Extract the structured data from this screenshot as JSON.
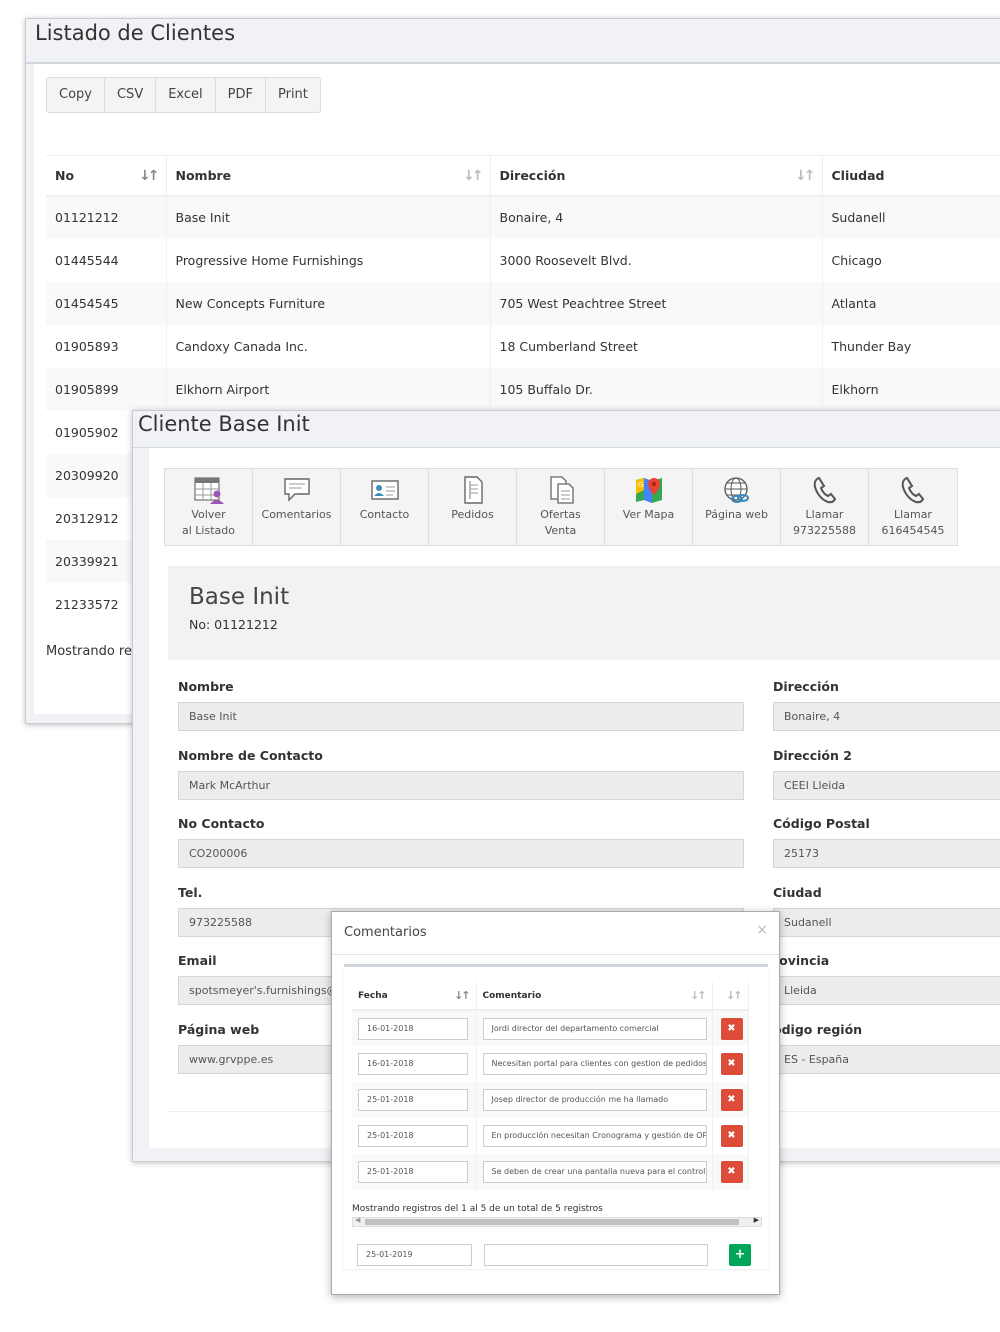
{
  "list_window": {
    "title": "Listado de Clientes",
    "export_buttons": [
      "Copy",
      "CSV",
      "Excel",
      "PDF",
      "Print"
    ],
    "columns": [
      "No",
      "Nombre",
      "Dirección",
      "Cliudad"
    ],
    "rows": [
      [
        "01121212",
        "Base Init",
        "Bonaire, 4",
        "Sudanell"
      ],
      [
        "01445544",
        "Progressive Home Furnishings",
        "3000 Roosevelt Blvd.",
        "Chicago"
      ],
      [
        "01454545",
        "New Concepts Furniture",
        "705 West Peachtree Street",
        "Atlanta"
      ],
      [
        "01905893",
        "Candoxy Canada Inc.",
        "18 Cumberland Street",
        "Thunder Bay"
      ],
      [
        "01905899",
        "Elkhorn Airport",
        "105 Buffalo Dr.",
        "Elkhorn"
      ],
      [
        "01905902",
        "",
        "",
        ""
      ],
      [
        "20309920",
        "",
        "",
        ""
      ],
      [
        "20312912",
        "",
        "",
        ""
      ],
      [
        "20339921",
        "",
        "",
        ""
      ],
      [
        "21233572",
        "",
        "",
        ""
      ]
    ],
    "showing": "Mostrando reg"
  },
  "detail_window": {
    "title": "Cliente Base Init",
    "toolbar": [
      {
        "icon": "list-person-icon",
        "line1": "Volver",
        "line2": "al Listado"
      },
      {
        "icon": "chat-bubble-icon",
        "line1": "Comentarios",
        "line2": ""
      },
      {
        "icon": "contact-card-icon",
        "line1": "Contacto",
        "line2": ""
      },
      {
        "icon": "document-icon",
        "line1": "Pedidos",
        "line2": ""
      },
      {
        "icon": "documents-icon",
        "line1": "Ofertas",
        "line2": "Venta"
      },
      {
        "icon": "map-pin-icon",
        "line1": "Ver Mapa",
        "line2": ""
      },
      {
        "icon": "globe-link-icon",
        "line1": "Página web",
        "line2": ""
      },
      {
        "icon": "phone-icon",
        "line1": "Llamar",
        "line2": "973225588"
      },
      {
        "icon": "phone-icon",
        "line1": "Llamar",
        "line2": "616454545"
      }
    ],
    "header_name": "Base Init",
    "header_no": "No: 01121212",
    "left_fields": [
      {
        "label": "Nombre",
        "value": "Base Init"
      },
      {
        "label": "Nombre de Contacto",
        "value": "Mark McArthur"
      },
      {
        "label": "No Contacto",
        "value": "CO200006"
      },
      {
        "label": "Tel.",
        "value": "973225588"
      },
      {
        "label": "Email",
        "value": "spotsmeyer's.furnishings@cr"
      },
      {
        "label": "Página web",
        "value": "www.grvppe.es"
      }
    ],
    "right_fields": [
      {
        "label": "Dirección",
        "value": "Bonaire, 4"
      },
      {
        "label": "Dirección 2",
        "value": "CEEI Lleida"
      },
      {
        "label": "Código Postal",
        "value": "25173"
      },
      {
        "label": "Ciudad",
        "value": "Sudanell"
      },
      {
        "label": "rovincia",
        "value": "Lleida"
      },
      {
        "label": "ódigo región",
        "value": "ES - España"
      }
    ]
  },
  "comments_modal": {
    "title": "Comentarios",
    "close": "×",
    "columns": [
      "Fecha",
      "Comentario",
      ""
    ],
    "rows": [
      {
        "date": "16-01-2018",
        "text": "Jordi director del departamento comercial"
      },
      {
        "date": "16-01-2018",
        "text": "Necesitan portal para clientes con gestion de pedidos y c"
      },
      {
        "date": "25-01-2018",
        "text": "Josep director de producción me ha llamado"
      },
      {
        "date": "25-01-2018",
        "text": "En producción necesitan Cronograma y gestión de OP"
      },
      {
        "date": "25-01-2018",
        "text": "Se deben de crear una pantalla nueva para el control de"
      }
    ],
    "delete_symbol": "✖",
    "showing": "Mostrando registros del 1 al 5 de un total de 5 registros",
    "new_date": "25-01-2019",
    "new_comment": "",
    "add_symbol": "+"
  },
  "colors": {
    "danger": "#dd4b39",
    "success": "#00a65a",
    "border": "#d2d6de"
  }
}
